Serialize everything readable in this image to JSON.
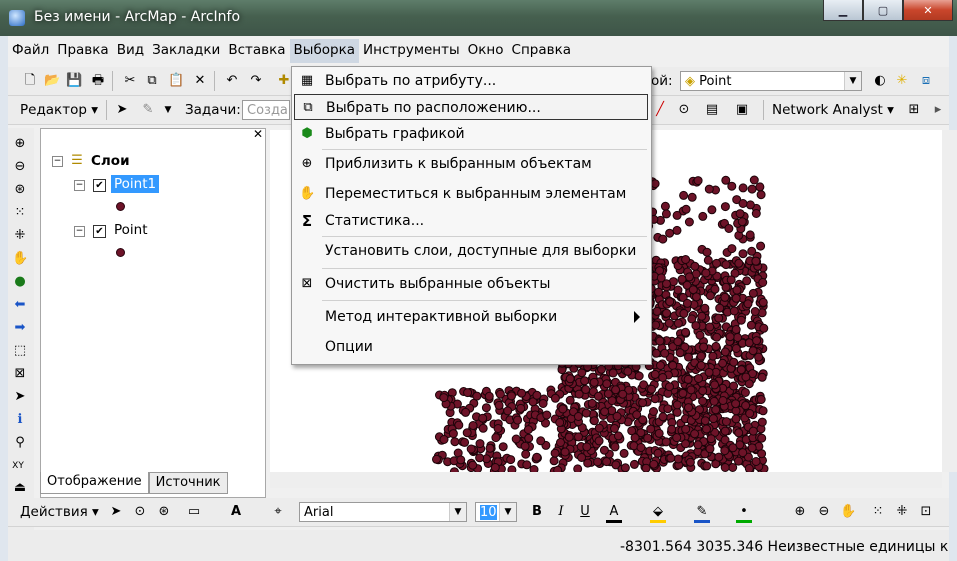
{
  "window": {
    "title": "Без имени - ArcMap - ArcInfo"
  },
  "menubar": [
    {
      "label": "Файл"
    },
    {
      "label": "Правка"
    },
    {
      "label": "Вид"
    },
    {
      "label": "Закладки"
    },
    {
      "label": "Вставка"
    },
    {
      "label": "Выборка"
    },
    {
      "label": "Инструменты"
    },
    {
      "label": "Окно"
    },
    {
      "label": "Справка"
    }
  ],
  "toolbar1": {
    "layer_label_partial": "ой:",
    "layer_value": "Point"
  },
  "toolbar2": {
    "editor": "Редактор",
    "tasks_label": "Задачи:",
    "tasks_value": "Созда",
    "network_analyst": "Network Analyst"
  },
  "toc": {
    "root": "Слои",
    "layers": [
      {
        "name": "Point1",
        "checked": "✔"
      },
      {
        "name": "Point",
        "checked": "✔"
      }
    ],
    "tabs": [
      {
        "label": "Отображение"
      },
      {
        "label": "Источник"
      }
    ]
  },
  "dropdown": {
    "items": [
      {
        "label": "Выбрать по атрибуту..."
      },
      {
        "label": "Выбрать по расположению..."
      },
      {
        "label": "Выбрать графикой"
      },
      {
        "label": "Приблизить к выбранным объектам"
      },
      {
        "label": "Переместиться к выбранным элементам"
      },
      {
        "label": "Статистика..."
      },
      {
        "label": "Установить слои, доступные для выборки"
      },
      {
        "label": "Очистить выбранные объекты"
      },
      {
        "label": "Метод интерактивной выборки"
      },
      {
        "label": "Опции"
      }
    ]
  },
  "drawing": {
    "actions": "Действия",
    "font": "Arial",
    "size": "10"
  },
  "status": {
    "coords": "-8301.564  3035.346 Неизвестные единицы к"
  },
  "colors": {
    "point_fill": "#6d1328",
    "title_bar": "#46604f",
    "accent": "#3399ff"
  }
}
